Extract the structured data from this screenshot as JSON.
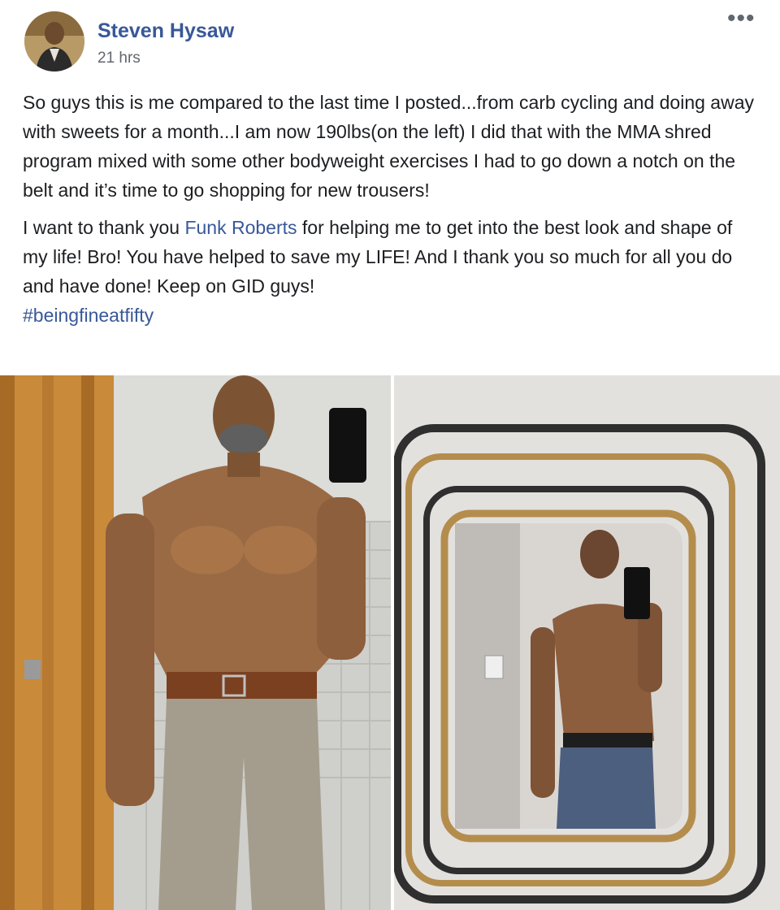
{
  "post": {
    "author": "Steven Hysaw",
    "time": "21 hrs",
    "more_label": "•••",
    "paragraph1": "So guys this is me compared to the last time I posted...from carb cycling and doing away with sweets for a month...I am now 190lbs(on the left) I did that with the MMA shred program mixed with some other bodyweight exercises I had to go down a notch on the belt and it’s time to go shopping for new trousers!",
    "paragraph2_before": "I want to thank you ",
    "mention": "Funk Roberts",
    "paragraph2_after": " for helping me to get into the best look and shape of my life! Bro! You have helped to save my LIFE! And I thank you so much for all you do and have done! Keep on GID guys!",
    "hashtag": "#beingfineatfifty"
  },
  "colors": {
    "link": "#385898",
    "text": "#1c1e21",
    "meta": "#606770"
  }
}
